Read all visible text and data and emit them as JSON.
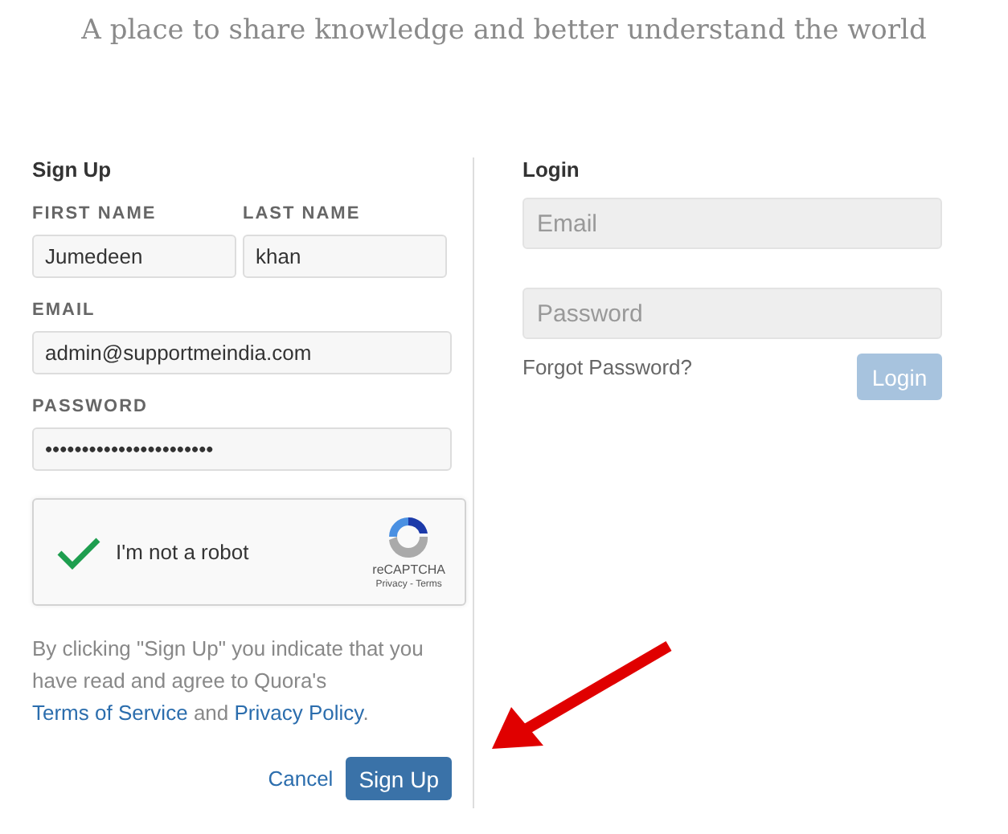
{
  "tagline": "A place to share knowledge and better understand the world",
  "signup": {
    "title": "Sign Up",
    "first_name": {
      "label": "FIRST NAME",
      "value": "Jumedeen"
    },
    "last_name": {
      "label": "LAST NAME",
      "value": "khan"
    },
    "email": {
      "label": "EMAIL",
      "value": "admin@supportmeindia.com"
    },
    "password": {
      "label": "PASSWORD",
      "value": "•••••••••••••••••••••••"
    },
    "captcha": {
      "label": "I'm not a robot",
      "checked": true,
      "brand": "reCAPTCHA",
      "links": "Privacy - Terms"
    },
    "terms": {
      "before": "By clicking \"Sign Up\" you indicate that you have read and agree to Quora's",
      "terms_link": "Terms of Service",
      "middle": "and",
      "privacy_link": "Privacy Policy",
      "after": "."
    },
    "cancel": "Cancel",
    "submit": "Sign Up"
  },
  "login": {
    "title": "Login",
    "email": {
      "placeholder": "Email"
    },
    "password": {
      "placeholder": "Password"
    },
    "forgot": "Forgot Password?",
    "submit": {
      "label": "Login",
      "disabled": true
    }
  }
}
